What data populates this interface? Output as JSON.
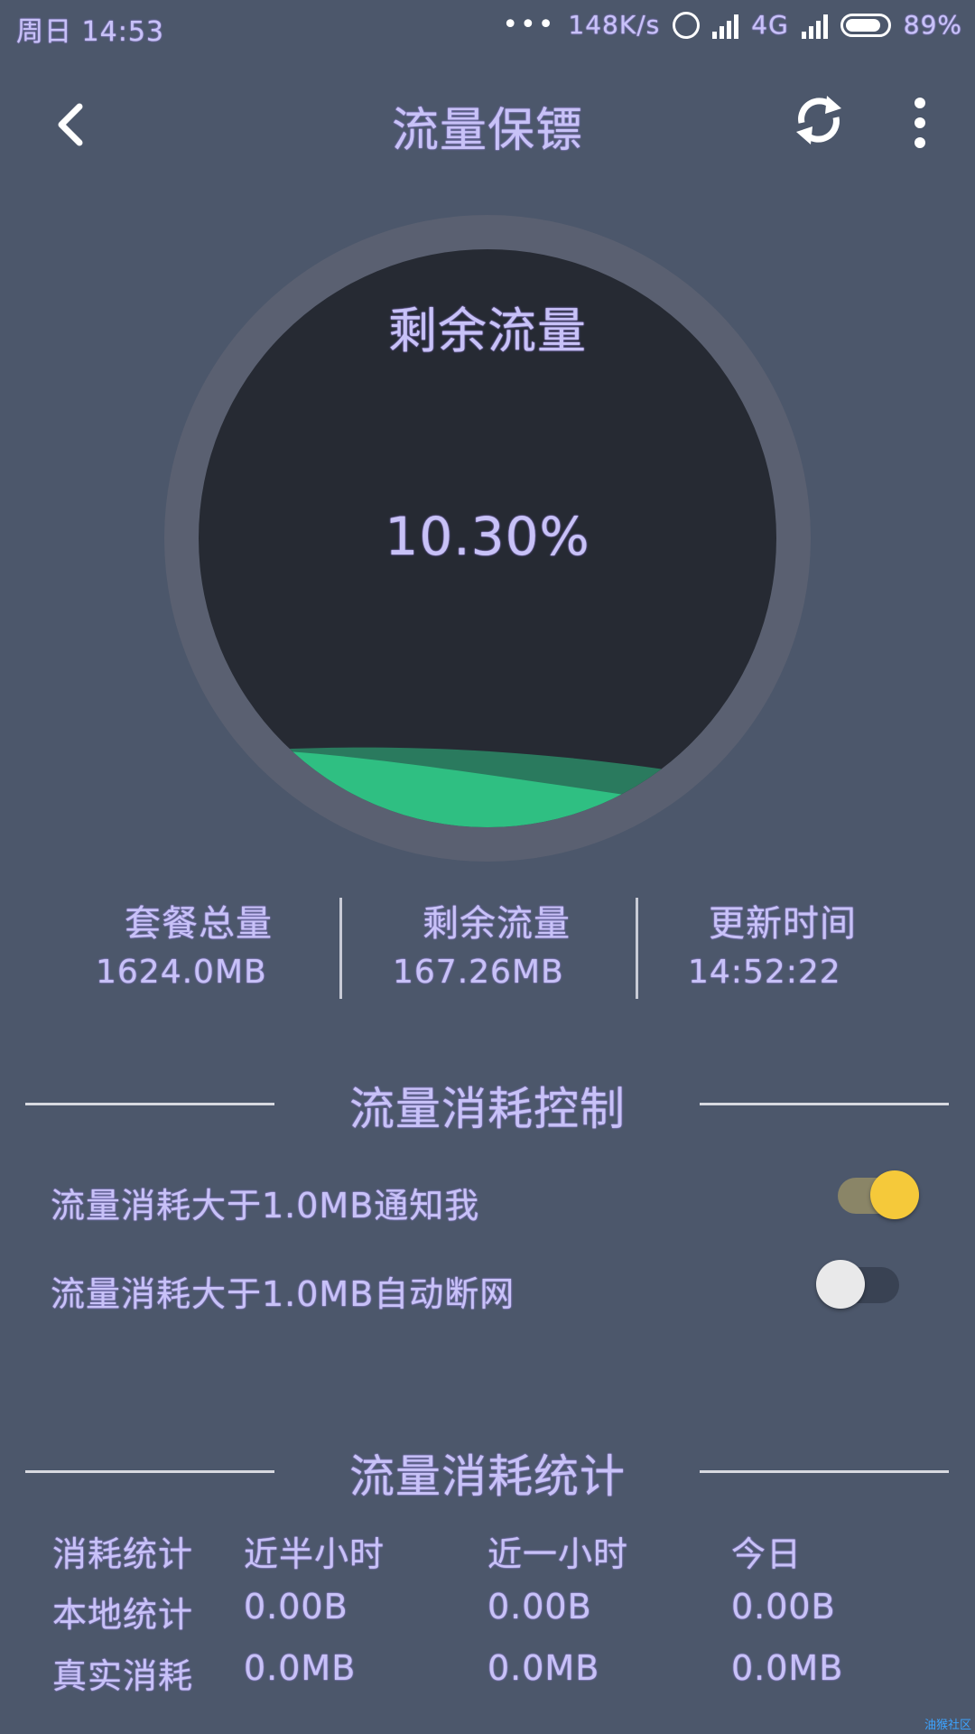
{
  "status_bar": {
    "time": "周日 14:53",
    "speed": "148K/s",
    "network": "4G",
    "battery": "89%",
    "icons": [
      "dots-icon",
      "alarm-icon",
      "signal-icon",
      "battery-icon"
    ]
  },
  "app_bar": {
    "title": "流量保镖",
    "icons": [
      "back-arrow-icon",
      "refresh-icon",
      "more-vert-icon"
    ]
  },
  "gauge": {
    "label": "剩余流量",
    "percent_text": "10.30%",
    "level": 0.103,
    "colors": {
      "ring": "#5a6071",
      "inner": "#262a33",
      "wave_front": "#2fbf82",
      "wave_back": "#2a7a5e"
    }
  },
  "info": {
    "total_label": "套餐总量",
    "total_value": "1624.0MB",
    "remain_label": "剩余流量",
    "remain_value": "167.26MB",
    "updated_label": "更新时间",
    "updated_value": "14:52:22"
  },
  "control_section": {
    "title": "流量消耗控制",
    "notify_label": "流量消耗大于1.0MB通知我",
    "notify_on": true,
    "disconnect_label": "流量消耗大于1.0MB自动断网",
    "disconnect_on": false,
    "colors": {
      "toggle_on_knob": "#f5c93a",
      "toggle_on_track": "#8a8567",
      "toggle_off_knob": "#e9e9ea",
      "toggle_off_track": "#394253"
    }
  },
  "stats_section": {
    "title": "流量消耗统计",
    "headers": [
      "消耗统计",
      "近半小时",
      "近一小时",
      "今日"
    ],
    "rows": [
      [
        "本地统计",
        "0.00B",
        "0.00B",
        "0.00B"
      ],
      [
        "真实消耗",
        "0.0MB",
        "0.0MB",
        "0.0MB"
      ]
    ]
  },
  "watermark": "油猴社区"
}
